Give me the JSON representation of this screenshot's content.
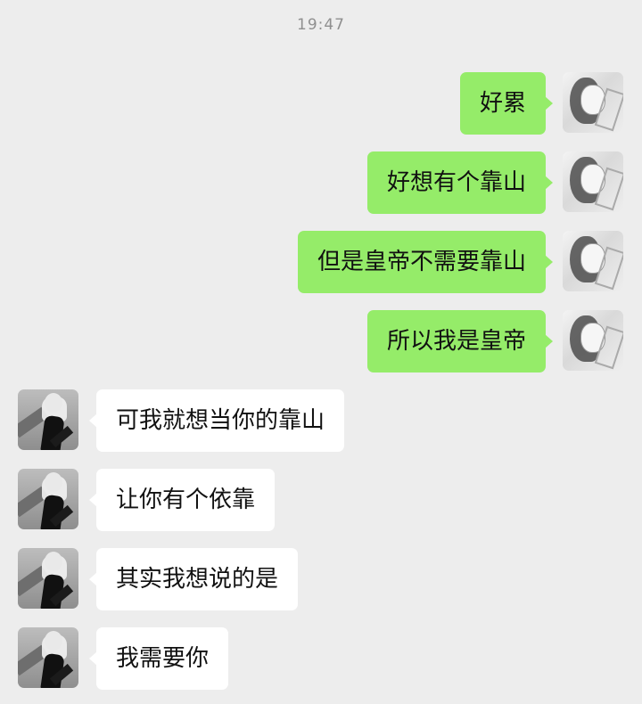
{
  "status": {
    "time": "19:47"
  },
  "messages": [
    {
      "side": "right",
      "text": "好累",
      "avatar": "self-avatar"
    },
    {
      "side": "right",
      "text": "好想有个靠山",
      "avatar": "self-avatar"
    },
    {
      "side": "right",
      "text": "但是皇帝不需要靠山",
      "avatar": "self-avatar"
    },
    {
      "side": "right",
      "text": "所以我是皇帝",
      "avatar": "self-avatar"
    },
    {
      "side": "left",
      "text": "可我就想当你的靠山",
      "avatar": "contact-avatar"
    },
    {
      "side": "left",
      "text": "让你有个依靠",
      "avatar": "contact-avatar"
    },
    {
      "side": "left",
      "text": "其实我想说的是",
      "avatar": "contact-avatar"
    },
    {
      "side": "left",
      "text": "我需要你",
      "avatar": "contact-avatar"
    }
  ],
  "colors": {
    "background": "#ededed",
    "sent_bubble": "#95ec69",
    "received_bubble": "#ffffff",
    "timestamp": "#8f8f8f"
  }
}
